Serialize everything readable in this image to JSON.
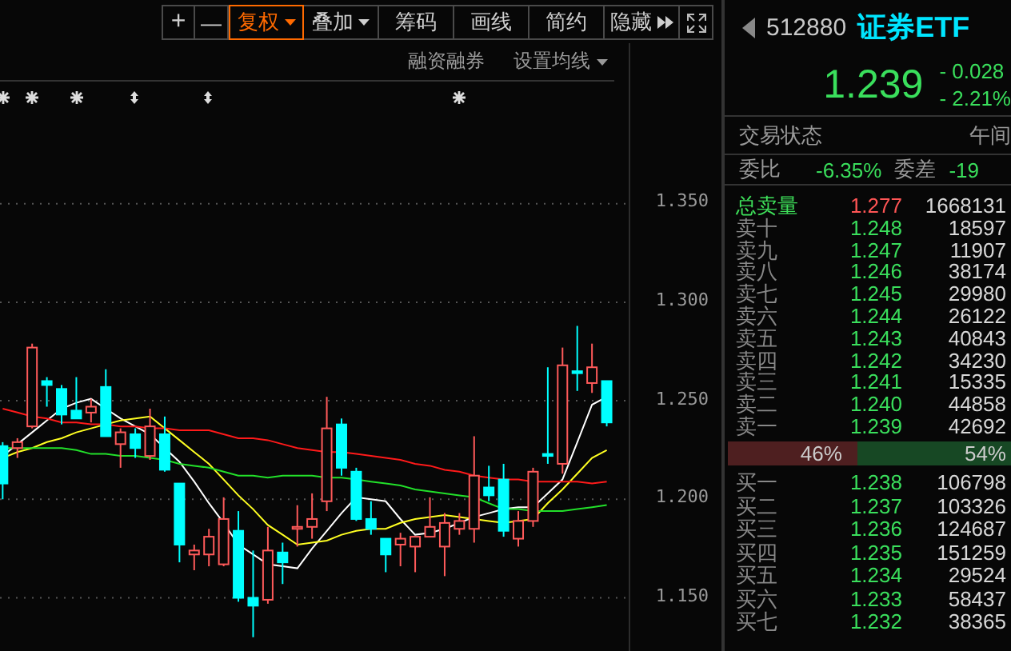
{
  "toolbar": {
    "buttons": [
      {
        "label": "+",
        "kind": "plain",
        "selected": false
      },
      {
        "label": "—",
        "kind": "plain",
        "selected": false
      },
      {
        "label": "复权",
        "kind": "dropdown",
        "selected": true
      },
      {
        "label": "叠加",
        "kind": "dropdown",
        "selected": false
      },
      {
        "label": "筹码",
        "kind": "plain",
        "selected": false
      },
      {
        "label": "画线",
        "kind": "plain",
        "selected": false
      },
      {
        "label": "简约",
        "kind": "plain",
        "selected": false
      },
      {
        "label": "隐藏",
        "kind": "expand",
        "selected": false
      },
      {
        "kind": "fullscreen",
        "selected": false
      }
    ]
  },
  "chart": {
    "links": [
      {
        "label": "融资融券",
        "kind": "plain"
      },
      {
        "label": "设置均线",
        "kind": "dropdown"
      }
    ],
    "markers": [
      {
        "kind": "star"
      },
      {
        "kind": "star"
      },
      {
        "kind": "star"
      },
      {
        "kind": "updown"
      },
      {
        "kind": "updown"
      },
      {
        "kind": "star"
      }
    ],
    "chart_data": {
      "type": "candlestick",
      "grid": true,
      "ylim": [
        1.123,
        1.412
      ],
      "ohlc": [
        [
          1.227,
          1.229,
          1.2,
          1.208
        ],
        [
          1.226,
          1.231,
          1.221,
          1.229
        ],
        [
          1.237,
          1.279,
          1.236,
          1.277
        ],
        [
          1.26,
          1.262,
          1.247,
          1.258
        ],
        [
          1.256,
          1.258,
          1.238,
          1.243
        ],
        [
          1.245,
          1.262,
          1.241,
          1.241
        ],
        [
          1.244,
          1.251,
          1.239,
          1.247
        ],
        [
          1.257,
          1.266,
          1.232,
          1.232
        ],
        [
          1.228,
          1.236,
          1.216,
          1.234
        ],
        [
          1.233,
          1.236,
          1.221,
          1.226
        ],
        [
          1.222,
          1.246,
          1.22,
          1.237
        ],
        [
          1.233,
          1.242,
          1.214,
          1.215
        ],
        [
          1.208,
          1.208,
          1.168,
          1.177
        ],
        [
          1.172,
          1.177,
          1.164,
          1.174
        ],
        [
          1.172,
          1.185,
          1.166,
          1.181
        ],
        [
          1.167,
          1.201,
          1.166,
          1.19
        ],
        [
          1.184,
          1.194,
          1.148,
          1.15
        ],
        [
          1.15,
          1.174,
          1.13,
          1.146
        ],
        [
          1.149,
          1.186,
          1.147,
          1.174
        ],
        [
          1.173,
          1.178,
          1.157,
          1.168
        ],
        [
          1.185,
          1.197,
          1.176,
          1.186
        ],
        [
          1.186,
          1.203,
          1.18,
          1.19
        ],
        [
          1.199,
          1.252,
          1.194,
          1.236
        ],
        [
          1.238,
          1.241,
          1.212,
          1.216
        ],
        [
          1.214,
          1.216,
          1.189,
          1.19
        ],
        [
          1.19,
          1.199,
          1.182,
          1.185
        ],
        [
          1.18,
          1.18,
          1.163,
          1.172
        ],
        [
          1.177,
          1.183,
          1.166,
          1.18
        ],
        [
          1.176,
          1.181,
          1.163,
          1.181
        ],
        [
          1.181,
          1.201,
          1.181,
          1.186
        ],
        [
          1.176,
          1.193,
          1.161,
          1.188
        ],
        [
          1.185,
          1.193,
          1.182,
          1.189
        ],
        [
          1.185,
          1.232,
          1.178,
          1.212
        ],
        [
          1.206,
          1.217,
          1.199,
          1.202
        ],
        [
          1.21,
          1.218,
          1.181,
          1.184
        ],
        [
          1.18,
          1.194,
          1.176,
          1.189
        ],
        [
          1.189,
          1.216,
          1.186,
          1.214
        ],
        [
          1.223,
          1.267,
          1.218,
          1.222
        ],
        [
          1.218,
          1.277,
          1.213,
          1.268
        ],
        [
          1.265,
          1.288,
          1.255,
          1.264
        ],
        [
          1.259,
          1.279,
          1.254,
          1.267
        ],
        [
          1.26,
          1.26,
          1.237,
          1.239
        ]
      ],
      "series": [
        {
          "type": "line",
          "color": "#ffffff",
          "values": [
            1.222,
            1.228,
            1.234,
            1.24,
            1.246,
            1.249,
            1.251,
            1.246,
            1.241,
            1.237,
            1.233,
            1.226,
            1.219,
            1.209,
            1.198,
            1.188,
            1.177,
            1.172,
            1.167,
            1.166,
            1.165,
            1.175,
            1.184,
            1.193,
            1.201,
            1.2,
            1.199,
            1.19,
            1.182,
            1.183,
            1.185,
            1.188,
            1.191,
            1.193,
            1.195,
            1.196,
            1.196,
            1.203,
            1.21,
            1.229,
            1.248,
            1.252
          ]
        },
        {
          "type": "line",
          "color": "#ffff22",
          "values": [
            1.221,
            1.224,
            1.226,
            1.229,
            1.231,
            1.234,
            1.236,
            1.238,
            1.24,
            1.241,
            1.242,
            1.236,
            1.23,
            1.224,
            1.218,
            1.21,
            1.202,
            1.195,
            1.187,
            1.182,
            1.177,
            1.178,
            1.179,
            1.182,
            1.184,
            1.185,
            1.185,
            1.188,
            1.19,
            1.191,
            1.192,
            1.191,
            1.19,
            1.189,
            1.188,
            1.189,
            1.19,
            1.198,
            1.205,
            1.213,
            1.221,
            1.225
          ]
        },
        {
          "type": "line",
          "color": "#22e02a",
          "values": [
            1.226,
            1.226,
            1.226,
            1.226,
            1.226,
            1.225,
            1.223,
            1.223,
            1.222,
            1.222,
            1.221,
            1.22,
            1.218,
            1.217,
            1.216,
            1.214,
            1.212,
            1.212,
            1.211,
            1.212,
            1.212,
            1.212,
            1.211,
            1.211,
            1.21,
            1.209,
            1.208,
            1.207,
            1.205,
            1.204,
            1.203,
            1.202,
            1.201,
            1.198,
            1.195,
            1.195,
            1.194,
            1.194,
            1.194,
            1.195,
            1.196,
            1.197
          ]
        },
        {
          "type": "line",
          "color": "#ff1a1a",
          "values": [
            1.246,
            1.244,
            1.242,
            1.241,
            1.239,
            1.239,
            1.238,
            1.238,
            1.237,
            1.237,
            1.236,
            1.236,
            1.235,
            1.235,
            1.235,
            1.233,
            1.231,
            1.231,
            1.23,
            1.228,
            1.226,
            1.225,
            1.224,
            1.224,
            1.223,
            1.222,
            1.221,
            1.22,
            1.218,
            1.217,
            1.215,
            1.214,
            1.212,
            1.211,
            1.21,
            1.21,
            1.209,
            1.209,
            1.209,
            1.209,
            1.208,
            1.209
          ]
        }
      ],
      "yticks": [
        {
          "value": 1.35,
          "label": "1.350"
        },
        {
          "value": 1.3,
          "label": "1.300"
        },
        {
          "value": 1.25,
          "label": "1.250"
        },
        {
          "value": 1.2,
          "label": "1.200"
        },
        {
          "value": 1.15,
          "label": "1.150"
        }
      ]
    }
  },
  "quote": {
    "code": "512880",
    "name": "证券ETF",
    "price": "1.239",
    "change": "- 0.028",
    "change_pct": "- 2.21%",
    "status_label": "交易状态",
    "status_value": "午间",
    "ratio_label": "委比",
    "ratio_value": "-6.35%",
    "diff_label": "委差",
    "diff_value": "-19"
  },
  "order_book": {
    "total_sell": {
      "label": "总卖量",
      "price": "1.277",
      "rising": true,
      "volume": "1668131"
    },
    "asks": [
      {
        "label": "卖十",
        "price": "1.248",
        "rising": false,
        "volume": "18597"
      },
      {
        "label": "卖九",
        "price": "1.247",
        "rising": false,
        "volume": "11907"
      },
      {
        "label": "卖八",
        "price": "1.246",
        "rising": false,
        "volume": "38174"
      },
      {
        "label": "卖七",
        "price": "1.245",
        "rising": false,
        "volume": "29980"
      },
      {
        "label": "卖六",
        "price": "1.244",
        "rising": false,
        "volume": "26122"
      },
      {
        "label": "卖五",
        "price": "1.243",
        "rising": false,
        "volume": "40843"
      },
      {
        "label": "卖四",
        "price": "1.242",
        "rising": false,
        "volume": "34230"
      },
      {
        "label": "卖三",
        "price": "1.241",
        "rising": false,
        "volume": "15335"
      },
      {
        "label": "卖二",
        "price": "1.240",
        "rising": false,
        "volume": "44858"
      },
      {
        "label": "卖一",
        "price": "1.239",
        "rising": false,
        "volume": "42692"
      }
    ],
    "balance": {
      "sell_text": "46%",
      "buy_text": "54%",
      "level": 0.46
    },
    "bids": [
      {
        "label": "买一",
        "price": "1.238",
        "rising": false,
        "volume": "106798"
      },
      {
        "label": "买二",
        "price": "1.237",
        "rising": false,
        "volume": "103326"
      },
      {
        "label": "买三",
        "price": "1.236",
        "rising": false,
        "volume": "124687"
      },
      {
        "label": "买四",
        "price": "1.235",
        "rising": false,
        "volume": "151259"
      },
      {
        "label": "买五",
        "price": "1.234",
        "rising": false,
        "volume": "29524"
      },
      {
        "label": "买六",
        "price": "1.233",
        "rising": false,
        "volume": "58437"
      },
      {
        "label": "买七",
        "price": "1.232",
        "rising": false,
        "volume": "38365"
      }
    ]
  }
}
